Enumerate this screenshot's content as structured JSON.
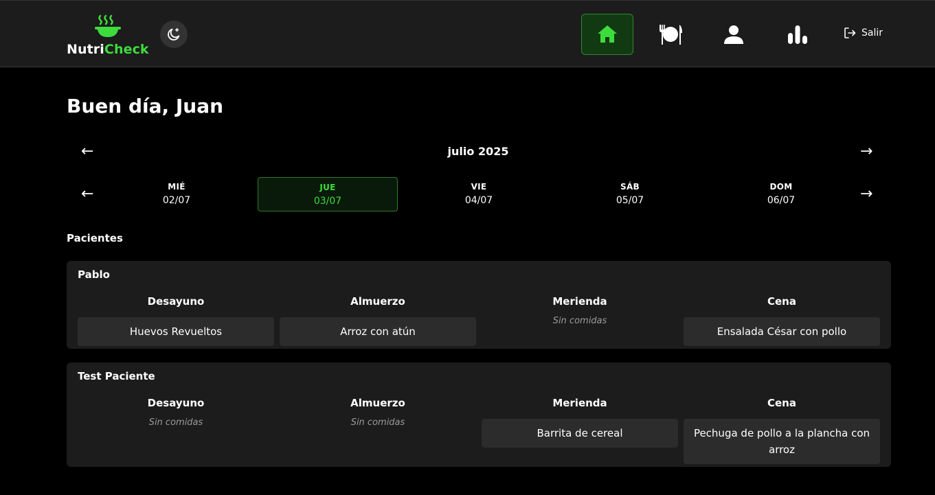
{
  "header": {
    "logo": {
      "text_white": "Nutri",
      "text_green": "Check",
      "icon": "steaming-pot-icon"
    },
    "theme_toggle_icon": "moon-star-icon",
    "nav": [
      {
        "id": "home",
        "icon": "home-icon",
        "active": true
      },
      {
        "id": "meals",
        "icon": "plate-cutlery-icon",
        "active": false
      },
      {
        "id": "patients",
        "icon": "user-icon",
        "active": false
      },
      {
        "id": "stats",
        "icon": "bar-chart-icon",
        "active": false
      }
    ],
    "logout": {
      "label": "Salir",
      "icon": "logout-icon"
    }
  },
  "main": {
    "greeting": "Buen día, Juan",
    "calendar": {
      "month": "julio 2025",
      "prev_arrow": "←",
      "next_arrow": "→",
      "days": [
        {
          "name": "MIÉ",
          "date": "02/07",
          "selected": false
        },
        {
          "name": "JUE",
          "date": "03/07",
          "selected": true
        },
        {
          "name": "VIE",
          "date": "04/07",
          "selected": false
        },
        {
          "name": "SÁB",
          "date": "05/07",
          "selected": false
        },
        {
          "name": "DOM",
          "date": "06/07",
          "selected": false
        }
      ]
    },
    "patients_title": "Pacientes",
    "patients": [
      {
        "name": "Pablo",
        "meals": [
          {
            "label": "Desayuno",
            "items": [
              "Huevos Revueltos"
            ]
          },
          {
            "label": "Almuerzo",
            "items": [
              "Arroz con atún"
            ]
          },
          {
            "label": "Merienda",
            "items": [],
            "empty": "Sin comidas"
          },
          {
            "label": "Cena",
            "items": [
              "Ensalada César con pollo"
            ]
          }
        ]
      },
      {
        "name": "Test Paciente",
        "meals": [
          {
            "label": "Desayuno",
            "items": [],
            "empty": "Sin comidas"
          },
          {
            "label": "Almuerzo",
            "items": [],
            "empty": "Sin comidas"
          },
          {
            "label": "Merienda",
            "items": [
              "Barrita de cereal"
            ]
          },
          {
            "label": "Cena",
            "items": [
              "Pechuga de pollo a la plancha con arroz"
            ]
          }
        ]
      }
    ]
  },
  "colors": {
    "accent": "#3ddc3d",
    "background": "#000000",
    "surface": "#1c1c1c",
    "item": "#2c2c2c"
  }
}
